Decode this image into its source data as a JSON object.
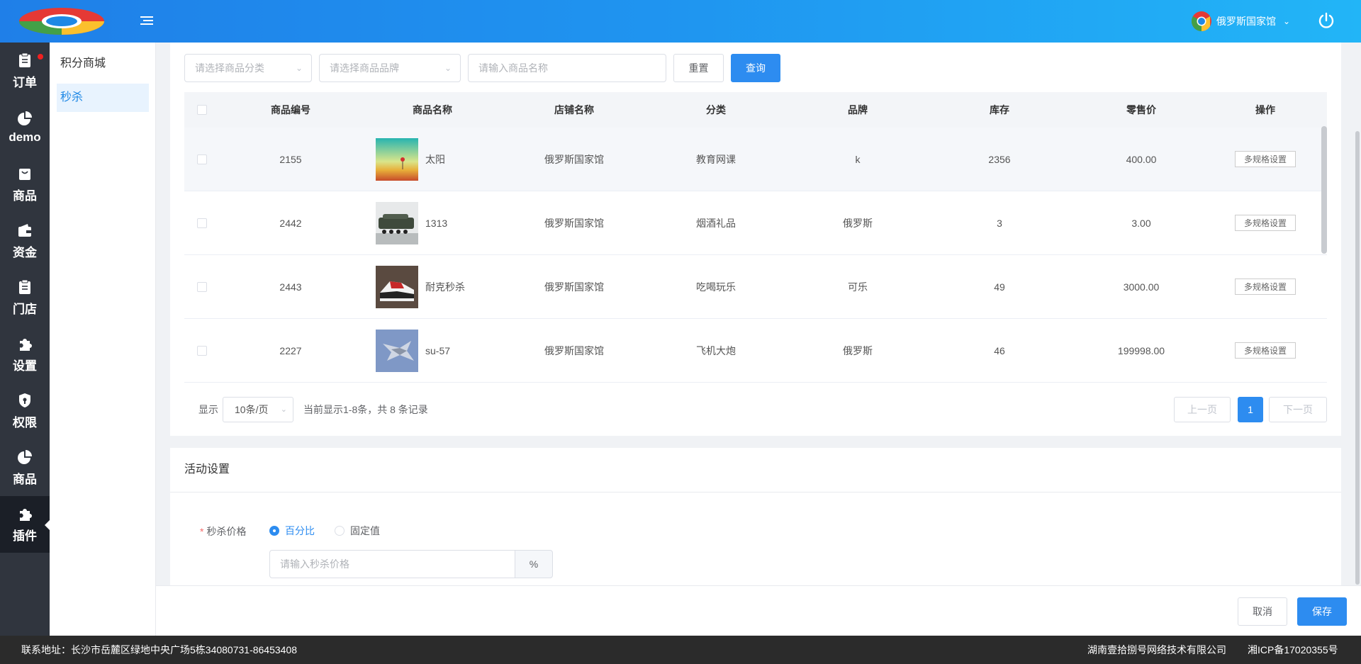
{
  "header": {
    "user_name": "俄罗斯国家馆"
  },
  "sidebar": {
    "items": [
      {
        "label": "订单",
        "icon": "clipboard-icon",
        "badge": true
      },
      {
        "label": "demo",
        "icon": "pie-chart-icon"
      },
      {
        "label": "商品",
        "icon": "bag-icon"
      },
      {
        "label": "资金",
        "icon": "wallet-icon"
      },
      {
        "label": "门店",
        "icon": "clipboard-icon"
      },
      {
        "label": "设置",
        "icon": "puzzle-icon"
      },
      {
        "label": "权限",
        "icon": "shield-icon"
      },
      {
        "label": "商品",
        "icon": "pie-chart-icon"
      },
      {
        "label": "插件",
        "icon": "puzzle-icon",
        "active": true
      }
    ]
  },
  "subnav": {
    "items": [
      {
        "label": "积分商城"
      },
      {
        "label": "秒杀",
        "active": true
      }
    ]
  },
  "filters": {
    "category_placeholder": "请选择商品分类",
    "brand_placeholder": "请选择商品品牌",
    "name_placeholder": "请输入商品名称",
    "reset_label": "重置",
    "query_label": "查询"
  },
  "table": {
    "headers": {
      "code": "商品编号",
      "name": "商品名称",
      "shop": "店铺名称",
      "category": "分类",
      "brand": "品牌",
      "stock": "库存",
      "price": "零售价",
      "op": "操作"
    },
    "rows": [
      {
        "code": "2155",
        "name": "太阳",
        "shop": "俄罗斯国家馆",
        "category": "教育网课",
        "brand": "k",
        "stock": "2356",
        "price": "400.00",
        "op": "多规格设置"
      },
      {
        "code": "2442",
        "name": "1313",
        "shop": "俄罗斯国家馆",
        "category": "烟酒礼品",
        "brand": "俄罗斯",
        "stock": "3",
        "price": "3.00",
        "op": "多规格设置"
      },
      {
        "code": "2443",
        "name": "耐克秒杀",
        "shop": "俄罗斯国家馆",
        "category": "吃喝玩乐",
        "brand": "可乐",
        "stock": "49",
        "price": "3000.00",
        "op": "多规格设置"
      },
      {
        "code": "2227",
        "name": "su-57",
        "shop": "俄罗斯国家馆",
        "category": "飞机大炮",
        "brand": "俄罗斯",
        "stock": "46",
        "price": "199998.00",
        "op": "多规格设置"
      }
    ]
  },
  "pagination": {
    "show_label": "显示",
    "page_size": "10条/页",
    "info": "当前显示1-8条，共 8 条记录",
    "prev": "上一页",
    "current": "1",
    "next": "下一页"
  },
  "activity": {
    "title": "活动设置",
    "price_label": "秒杀价格",
    "radio_percent": "百分比",
    "radio_fixed": "固定值",
    "price_placeholder": "请输入秒杀价格",
    "suffix": "%"
  },
  "actions": {
    "cancel": "取消",
    "save": "保存"
  },
  "footer": {
    "address": "联系地址：长沙市岳麓区绿地中央广场5栋34080731-86453408",
    "company": "湖南壹拾捌号网络技术有限公司",
    "icp": "湘ICP备17020355号"
  },
  "colors": {
    "primary": "#2d8cf0",
    "sidebar_bg": "#30353e",
    "header_gradient_start": "#1f7fe8",
    "header_gradient_end": "#22b5f7"
  }
}
